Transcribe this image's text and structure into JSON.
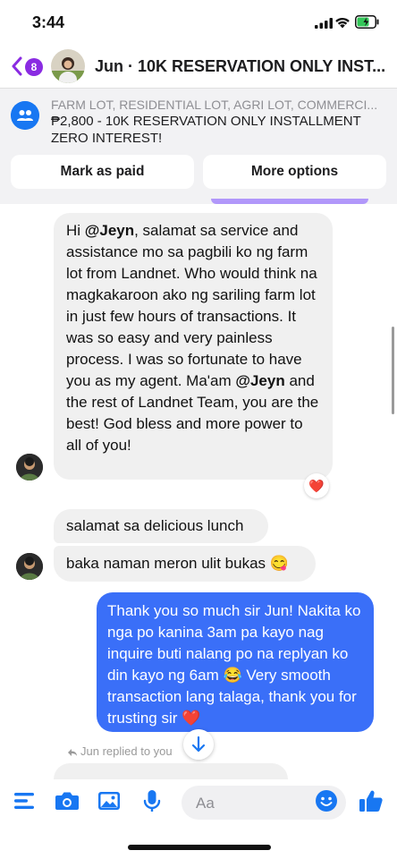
{
  "status": {
    "time": "3:44"
  },
  "header": {
    "back_badge": "8",
    "title": "Jun · 10K RESERVATION ONLY INST..."
  },
  "listing": {
    "subtitle": "FARM LOT, RESIDENTIAL LOT, AGRI LOT, COMMERCI...",
    "title": "₱2,800 - 10K RESERVATION ONLY INSTALLMENT ZERO INTEREST!",
    "mark_paid_label": "Mark as paid",
    "more_options_label": "More options"
  },
  "messages": {
    "m1_part1": "Hi ",
    "m1_mention1": "@Jeyn",
    "m1_part2": ", salamat sa service and assistance mo sa pagbili ko ng farm lot from Landnet.  Who would think na magkakaroon ako ng sariling farm lot in just few hours of transactions. It was so easy and very painless process.  I was so fortunate to have you as my agent. Ma'am ",
    "m1_mention2": "@Jeyn",
    "m1_part3": " and the rest of Landnet Team, you are the best! God bless and more power to all of you!",
    "m1_reaction": "❤️",
    "m2": "salamat sa delicious lunch",
    "m3": "baka naman meron ulit bukas 😋",
    "m4": "Thank you so much sir Jun! Nakita ko nga po kanina 3am pa kayo nag inquire buti nalang po na replyan ko din kayo ng 6am 😂 Very smooth transaction lang talaga, thank you for trusting sir ❤️",
    "reply_indicator": "Jun replied to you"
  },
  "composer": {
    "placeholder": "Aa"
  },
  "colors": {
    "accent": "#1877f2",
    "outgoing_bubble": "#3a6ff8",
    "badge": "#8a2be2",
    "incoming_bubble": "#f0f0f0"
  },
  "icons": [
    "back-chevron-icon",
    "group-icon",
    "menu-icon",
    "camera-icon",
    "image-icon",
    "microphone-icon",
    "emoji-icon",
    "thumbs-up-icon",
    "arrow-down-icon",
    "reply-icon"
  ]
}
